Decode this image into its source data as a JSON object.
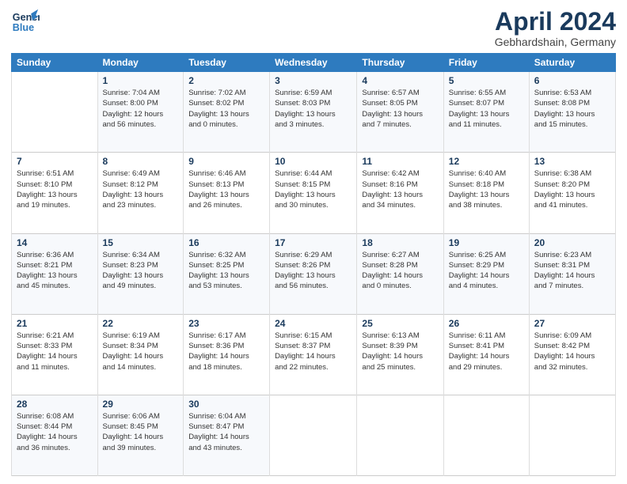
{
  "header": {
    "logo_line1": "General",
    "logo_line2": "Blue",
    "title": "April 2024",
    "subtitle": "Gebhardshain, Germany"
  },
  "days_of_week": [
    "Sunday",
    "Monday",
    "Tuesday",
    "Wednesday",
    "Thursday",
    "Friday",
    "Saturday"
  ],
  "weeks": [
    [
      {
        "day": "",
        "info": ""
      },
      {
        "day": "1",
        "info": "Sunrise: 7:04 AM\nSunset: 8:00 PM\nDaylight: 12 hours\nand 56 minutes."
      },
      {
        "day": "2",
        "info": "Sunrise: 7:02 AM\nSunset: 8:02 PM\nDaylight: 13 hours\nand 0 minutes."
      },
      {
        "day": "3",
        "info": "Sunrise: 6:59 AM\nSunset: 8:03 PM\nDaylight: 13 hours\nand 3 minutes."
      },
      {
        "day": "4",
        "info": "Sunrise: 6:57 AM\nSunset: 8:05 PM\nDaylight: 13 hours\nand 7 minutes."
      },
      {
        "day": "5",
        "info": "Sunrise: 6:55 AM\nSunset: 8:07 PM\nDaylight: 13 hours\nand 11 minutes."
      },
      {
        "day": "6",
        "info": "Sunrise: 6:53 AM\nSunset: 8:08 PM\nDaylight: 13 hours\nand 15 minutes."
      }
    ],
    [
      {
        "day": "7",
        "info": ""
      },
      {
        "day": "8",
        "info": "Sunrise: 6:49 AM\nSunset: 8:12 PM\nDaylight: 13 hours\nand 23 minutes."
      },
      {
        "day": "9",
        "info": "Sunrise: 6:46 AM\nSunset: 8:13 PM\nDaylight: 13 hours\nand 26 minutes."
      },
      {
        "day": "10",
        "info": "Sunrise: 6:44 AM\nSunset: 8:15 PM\nDaylight: 13 hours\nand 30 minutes."
      },
      {
        "day": "11",
        "info": "Sunrise: 6:42 AM\nSunset: 8:16 PM\nDaylight: 13 hours\nand 34 minutes."
      },
      {
        "day": "12",
        "info": "Sunrise: 6:40 AM\nSunset: 8:18 PM\nDaylight: 13 hours\nand 38 minutes."
      },
      {
        "day": "13",
        "info": "Sunrise: 6:38 AM\nSunset: 8:20 PM\nDaylight: 13 hours\nand 41 minutes."
      }
    ],
    [
      {
        "day": "14",
        "info": ""
      },
      {
        "day": "15",
        "info": "Sunrise: 6:34 AM\nSunset: 8:23 PM\nDaylight: 13 hours\nand 49 minutes."
      },
      {
        "day": "16",
        "info": "Sunrise: 6:32 AM\nSunset: 8:25 PM\nDaylight: 13 hours\nand 53 minutes."
      },
      {
        "day": "17",
        "info": "Sunrise: 6:29 AM\nSunset: 8:26 PM\nDaylight: 13 hours\nand 56 minutes."
      },
      {
        "day": "18",
        "info": "Sunrise: 6:27 AM\nSunset: 8:28 PM\nDaylight: 14 hours\nand 0 minutes."
      },
      {
        "day": "19",
        "info": "Sunrise: 6:25 AM\nSunset: 8:29 PM\nDaylight: 14 hours\nand 4 minutes."
      },
      {
        "day": "20",
        "info": "Sunrise: 6:23 AM\nSunset: 8:31 PM\nDaylight: 14 hours\nand 7 minutes."
      }
    ],
    [
      {
        "day": "21",
        "info": "Sunrise: 6:21 AM\nSunset: 8:33 PM\nDaylight: 14 hours\nand 11 minutes."
      },
      {
        "day": "22",
        "info": "Sunrise: 6:19 AM\nSunset: 8:34 PM\nDaylight: 14 hours\nand 14 minutes."
      },
      {
        "day": "23",
        "info": "Sunrise: 6:17 AM\nSunset: 8:36 PM\nDaylight: 14 hours\nand 18 minutes."
      },
      {
        "day": "24",
        "info": "Sunrise: 6:15 AM\nSunset: 8:37 PM\nDaylight: 14 hours\nand 22 minutes."
      },
      {
        "day": "25",
        "info": "Sunrise: 6:13 AM\nSunset: 8:39 PM\nDaylight: 14 hours\nand 25 minutes."
      },
      {
        "day": "26",
        "info": "Sunrise: 6:11 AM\nSunset: 8:41 PM\nDaylight: 14 hours\nand 29 minutes."
      },
      {
        "day": "27",
        "info": "Sunrise: 6:09 AM\nSunset: 8:42 PM\nDaylight: 14 hours\nand 32 minutes."
      }
    ],
    [
      {
        "day": "28",
        "info": "Sunrise: 6:08 AM\nSunset: 8:44 PM\nDaylight: 14 hours\nand 36 minutes."
      },
      {
        "day": "29",
        "info": "Sunrise: 6:06 AM\nSunset: 8:45 PM\nDaylight: 14 hours\nand 39 minutes."
      },
      {
        "day": "30",
        "info": "Sunrise: 6:04 AM\nSunset: 8:47 PM\nDaylight: 14 hours\nand 43 minutes."
      },
      {
        "day": "",
        "info": ""
      },
      {
        "day": "",
        "info": ""
      },
      {
        "day": "",
        "info": ""
      },
      {
        "day": "",
        "info": ""
      }
    ]
  ],
  "week2_sunday_info": "Sunrise: 6:51 AM\nSunset: 8:10 PM\nDaylight: 13 hours\nand 19 minutes.",
  "week3_sunday_info": "Sunrise: 6:36 AM\nSunset: 8:21 PM\nDaylight: 13 hours\nand 45 minutes."
}
